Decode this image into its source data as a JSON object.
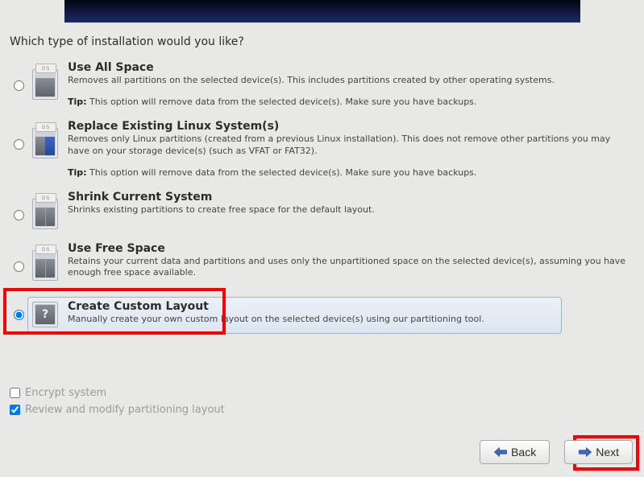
{
  "question": "Which type of installation would you like?",
  "options": [
    {
      "id": "use-all",
      "title": "Use All Space",
      "desc": "Removes all partitions on the selected device(s).  This includes partitions created by other operating systems.",
      "tip_label": "Tip:",
      "tip": " This option will remove data from the selected device(s).  Make sure you have backups.",
      "icon_label": "OS"
    },
    {
      "id": "replace-linux",
      "title": "Replace Existing Linux System(s)",
      "desc": "Removes only Linux partitions (created from a previous Linux installation).  This does not remove other partitions you may have on your storage device(s) (such as VFAT or FAT32).",
      "tip_label": "Tip:",
      "tip": " This option will remove data from the selected device(s).  Make sure you have backups.",
      "icon_label": "OS"
    },
    {
      "id": "shrink",
      "title": "Shrink Current System",
      "desc": "Shrinks existing partitions to create free space for the default layout.",
      "icon_label": "OS"
    },
    {
      "id": "free-space",
      "title": "Use Free Space",
      "desc": "Retains your current data and partitions and uses only the unpartitioned space on the selected device(s), assuming you have enough free space available.",
      "icon_label": "OS"
    },
    {
      "id": "custom",
      "title": "Create Custom Layout",
      "desc": "Manually create your own custom layout on the selected device(s) using our partitioning tool.",
      "selected": true
    }
  ],
  "checkboxes": {
    "encrypt": {
      "label": "Encrypt system",
      "checked": false
    },
    "review": {
      "label": "Review and modify partitioning layout",
      "checked": true
    }
  },
  "buttons": {
    "back": "Back",
    "next": "Next"
  }
}
